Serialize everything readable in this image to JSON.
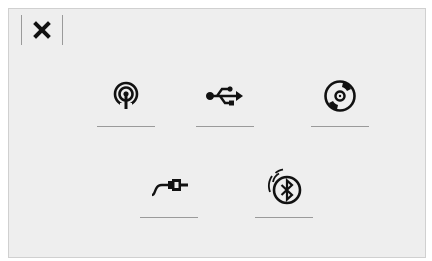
{
  "dialog": {
    "close": {
      "icon": "close-icon"
    },
    "sources": [
      {
        "id": "radio",
        "icon": "radio-broadcast-icon"
      },
      {
        "id": "usb",
        "icon": "usb-icon"
      },
      {
        "id": "cd",
        "icon": "cd-disc-icon"
      },
      {
        "id": "aux",
        "icon": "aux-cable-icon"
      },
      {
        "id": "bluetooth",
        "icon": "bluetooth-icon"
      }
    ]
  },
  "colors": {
    "panel_background": "#eeeeee",
    "panel_border": "#d0d0d0",
    "divider": "#9a9a9a",
    "icon": "#111111"
  }
}
